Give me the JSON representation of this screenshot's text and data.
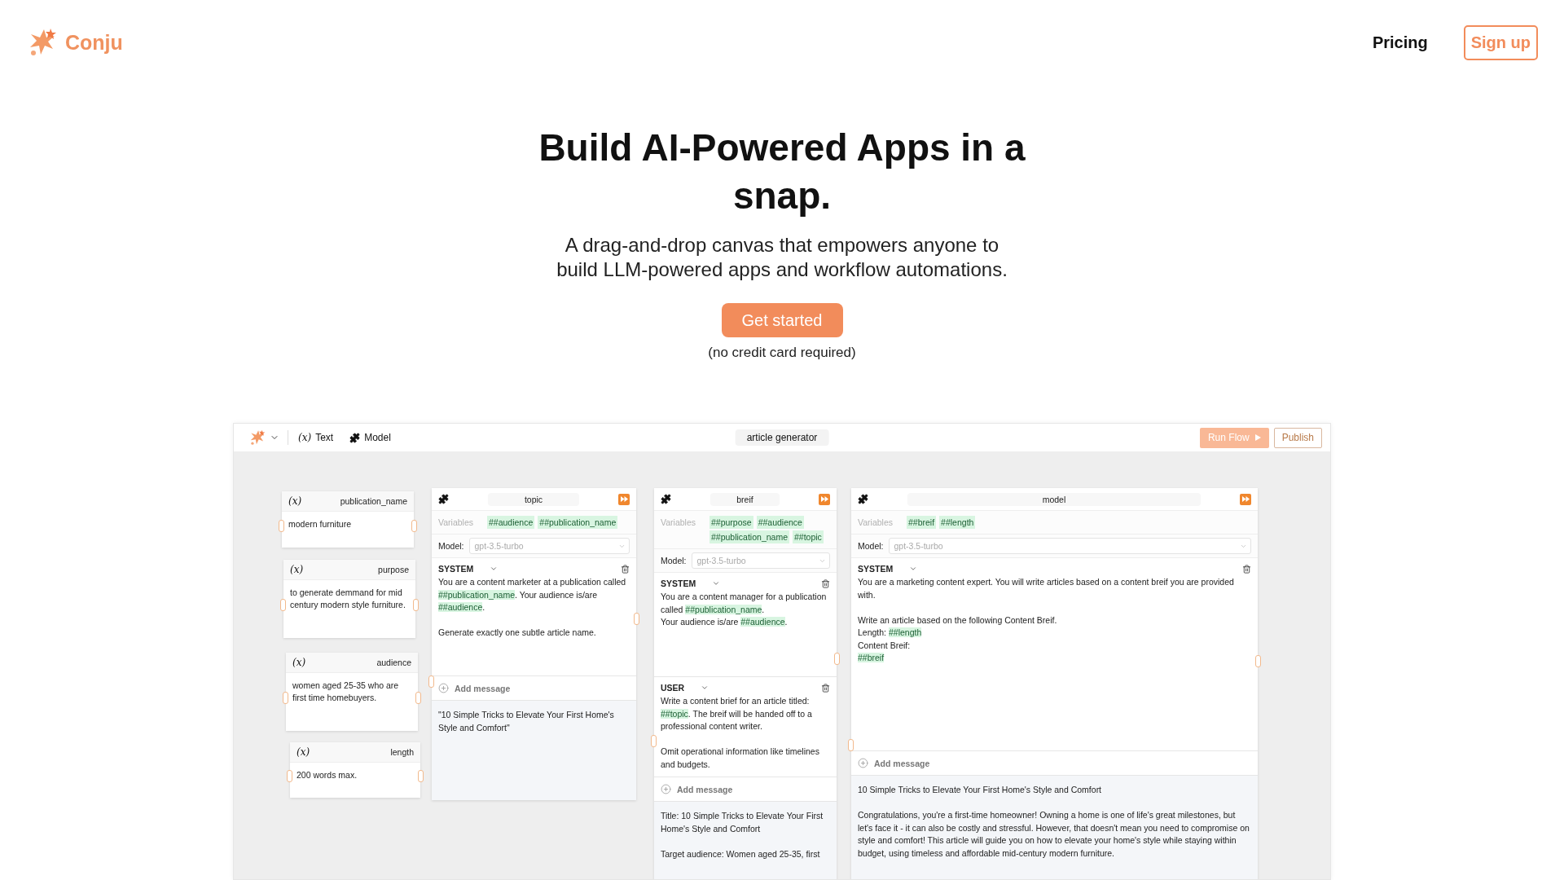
{
  "header": {
    "brand": "Conju",
    "nav": [
      {
        "kind": "link",
        "label": "Pricing"
      },
      {
        "kind": "button",
        "label": "Sign up"
      }
    ]
  },
  "hero": {
    "title": "Build AI-Powered Apps in a snap.",
    "subtitle": "A drag-and-drop canvas that empowers anyone to build LLM-powered apps and workflow automations.",
    "cta": "Get started",
    "note": "(no credit card required)"
  },
  "app": {
    "toolbar": {
      "tools": [
        {
          "kind": "variable",
          "glyph": "(x)",
          "label": "Text"
        },
        {
          "kind": "model",
          "label": "Model"
        }
      ],
      "flow_name": "article generator",
      "run_button": "Run Flow",
      "publish_button": "Publish"
    },
    "variable_nodes": [
      {
        "glyph": "(x)",
        "name": "publication_name",
        "value": "modern furniture"
      },
      {
        "glyph": "(x)",
        "name": "purpose",
        "value": "to generate demmand for mid century modern style furniture."
      },
      {
        "glyph": "(x)",
        "name": "audience",
        "value": "women aged 25-35 who are first time homebuyers."
      },
      {
        "glyph": "(x)",
        "name": "length",
        "value": "200 words max."
      }
    ],
    "model_nodes": [
      {
        "title": "topic",
        "variables_label": "Variables",
        "variables": [
          "##audience",
          "##publication_name"
        ],
        "model_label": "Model:",
        "model": "gpt-3.5-turbo",
        "messages": [
          {
            "role": "SYSTEM",
            "segments": [
              {
                "kind": "plain",
                "text": "You are a content marketer at a publication called "
              },
              {
                "kind": "variable",
                "text": "##publication_name"
              },
              {
                "kind": "plain",
                "text": ". Your audience is/are "
              },
              {
                "kind": "variable",
                "text": "##audience"
              },
              {
                "kind": "plain",
                "text": ".\n\nGenerate exactly one subtle article name."
              }
            ]
          }
        ],
        "add_message": "Add message",
        "output": "\"10 Simple Tricks to Elevate Your First Home's Style and Comfort\""
      },
      {
        "title": "breif",
        "variables_label": "Variables",
        "variables": [
          "##purpose",
          "##audience",
          "##publication_name",
          "##topic"
        ],
        "model_label": "Model:",
        "model": "gpt-3.5-turbo",
        "messages": [
          {
            "role": "SYSTEM",
            "segments": [
              {
                "kind": "plain",
                "text": "You are a content manager for a publication called "
              },
              {
                "kind": "variable",
                "text": "##publication_name"
              },
              {
                "kind": "plain",
                "text": ".\nYour audience is/are "
              },
              {
                "kind": "variable",
                "text": "##audience"
              },
              {
                "kind": "plain",
                "text": "."
              }
            ]
          },
          {
            "role": "USER",
            "segments": [
              {
                "kind": "plain",
                "text": "Write a content brief for an article titled: "
              },
              {
                "kind": "variable",
                "text": "##topic"
              },
              {
                "kind": "plain",
                "text": ". The breif will be handed off to a professional content writer.\n\nOmit operational information like timelines and budgets."
              }
            ]
          }
        ],
        "add_message": "Add message",
        "output": "Title: 10 Simple Tricks to Elevate Your First Home's Style and Comfort\n\nTarget audience: Women aged 25-35, first"
      },
      {
        "title": "model",
        "variables_label": "Variables",
        "variables": [
          "##breif",
          "##length"
        ],
        "model_label": "Model:",
        "model": "gpt-3.5-turbo",
        "messages": [
          {
            "role": "SYSTEM",
            "segments": [
              {
                "kind": "plain",
                "text": "You are a marketing content expert. You will write articles based on a content breif you are provided with.\n\nWrite an article based on the following Content Breif.\nLength: "
              },
              {
                "kind": "variable",
                "text": "##length"
              },
              {
                "kind": "plain",
                "text": "\nContent Breif:\n"
              },
              {
                "kind": "variable",
                "text": "##breif"
              }
            ]
          }
        ],
        "add_message": "Add message",
        "output": "10 Simple Tricks to Elevate Your First Home's Style and Comfort\n\nCongratulations, you're a first-time homeowner! Owning a home is one of life's great milestones, but let's face it - it can also be costly and stressful. However, that doesn't mean you need to compromise on style and comfort! This article will guide you on how to elevate your home's style while staying within budget, using timeless and affordable mid-century modern furniture."
      }
    ]
  }
}
